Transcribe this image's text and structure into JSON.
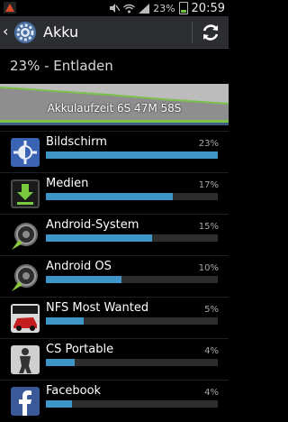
{
  "status_bar": {
    "battery_pct": "23%",
    "time": "20:59"
  },
  "action_bar": {
    "title": "Akku"
  },
  "summary": {
    "text": "23% - Entladen"
  },
  "graph": {
    "label": "Akkulaufzeit 6S 47M 58S"
  },
  "apps": [
    {
      "name": "Bildschirm",
      "percent_label": "23%",
      "share": 1.0,
      "icon": "display-settings-icon"
    },
    {
      "name": "Medien",
      "percent_label": "17%",
      "share": 0.74,
      "icon": "media-download-icon"
    },
    {
      "name": "Android-System",
      "percent_label": "15%",
      "share": 0.62,
      "icon": "android-system-icon"
    },
    {
      "name": "Android OS",
      "percent_label": "10%",
      "share": 0.44,
      "icon": "android-os-icon"
    },
    {
      "name": "NFS Most Wanted",
      "percent_label": "5%",
      "share": 0.22,
      "icon": "nfs-game-icon"
    },
    {
      "name": "CS Portable",
      "percent_label": "4%",
      "share": 0.17,
      "icon": "cs-portable-icon"
    },
    {
      "name": "Facebook",
      "percent_label": "4%",
      "share": 0.15,
      "icon": "facebook-icon"
    }
  ],
  "colors": {
    "accent": "#3f94c8",
    "graph_green": "#7bc24a",
    "background": "#000000"
  }
}
